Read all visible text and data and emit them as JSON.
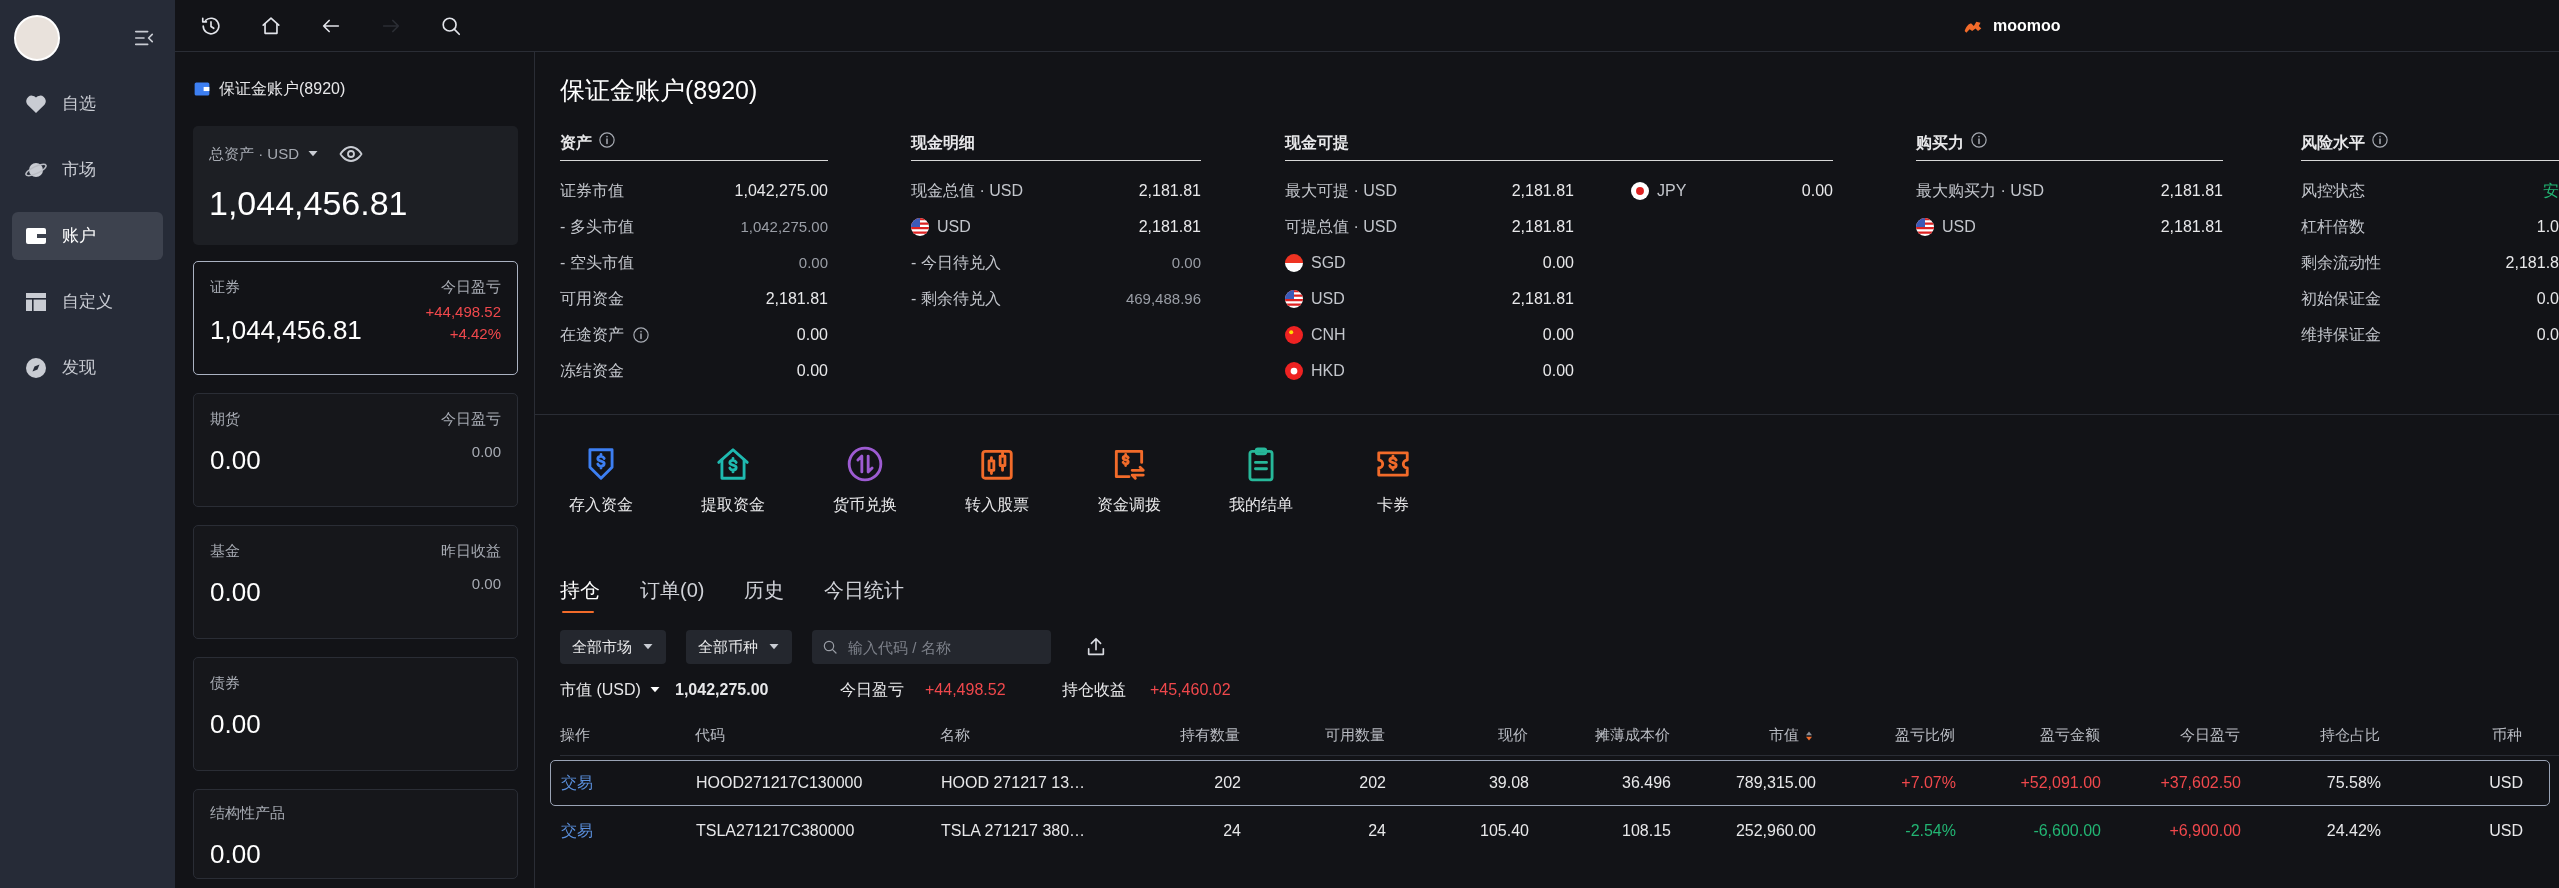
{
  "sidebar": {
    "items": [
      {
        "label": "自选",
        "selected": false
      },
      {
        "label": "市场",
        "selected": false
      },
      {
        "label": "账户",
        "selected": true
      },
      {
        "label": "自定义",
        "selected": false
      },
      {
        "label": "发现",
        "selected": false
      }
    ]
  },
  "toolbar": {
    "buttons": [
      {
        "disabled": false
      },
      {
        "disabled": false
      },
      {
        "disabled": false
      },
      {
        "disabled": true
      },
      {
        "disabled": false
      }
    ],
    "logo": "moomoo"
  },
  "account_panel": {
    "title": "保证金账户(8920)",
    "total": {
      "label": "总资产 · USD",
      "value": "1,044,456.81"
    },
    "cards": [
      {
        "name": "证券",
        "value": "1,044,456.81",
        "pnl_label": "今日盈亏",
        "pnl": "+44,498.52",
        "pnl_pct": "+4.42%",
        "kind": "up",
        "selected": true
      },
      {
        "name": "期货",
        "value": "0.00",
        "pnl_label": "今日盈亏",
        "pnl": "0.00",
        "kind": "flat",
        "selected": false
      },
      {
        "name": "基金",
        "value": "0.00",
        "pnl_label": "昨日收益",
        "pnl": "0.00",
        "kind": "flat",
        "selected": false
      },
      {
        "name": "债券",
        "value": "0.00",
        "selected": false
      },
      {
        "name": "结构性产品",
        "value": "0.00",
        "selected": false
      }
    ]
  },
  "page_title": "保证金账户(8920)",
  "sections": [
    {
      "title": "资产",
      "info": true,
      "columns": [
        [
          {
            "label": "证券市值",
            "value": "1,042,275.00",
            "kind": "plain"
          },
          {
            "label": "- 多头市值",
            "value": "1,042,275.00",
            "kind": "muted"
          },
          {
            "label": "- 空头市值",
            "value": "0.00",
            "kind": "muted"
          },
          {
            "label": "可用资金",
            "value": "2,181.81",
            "kind": "plain"
          },
          {
            "label": "在途资产",
            "value": "0.00",
            "kind": "info"
          },
          {
            "label": "冻结资金",
            "value": "0.00",
            "kind": "plain"
          }
        ]
      ]
    },
    {
      "title": "现金明细",
      "info": false,
      "columns": [
        [
          {
            "label": "现金总值 · USD",
            "value": "2,181.81",
            "kind": "plain"
          },
          {
            "label": "USD",
            "value": "2,181.81",
            "kind": "us"
          },
          {
            "label": "- 今日待兑入",
            "value": "0.00",
            "kind": "muted"
          },
          {
            "label": "- 剩余待兑入",
            "value": "469,488.96",
            "kind": "muted"
          }
        ]
      ]
    },
    {
      "title": "现金可提",
      "info": false,
      "columns": [
        [
          {
            "label": "最大可提 · USD",
            "value": "2,181.81",
            "kind": "plain"
          },
          {
            "label": "可提总值 · USD",
            "value": "2,181.81",
            "kind": "plain"
          },
          {
            "label": "SGD",
            "value": "0.00",
            "kind": "sg"
          },
          {
            "label": "USD",
            "value": "2,181.81",
            "kind": "us"
          },
          {
            "label": "CNH",
            "value": "0.00",
            "kind": "cn"
          },
          {
            "label": "HKD",
            "value": "0.00",
            "kind": "hk"
          }
        ],
        [
          {
            "label": "JPY",
            "value": "0.00",
            "kind": "jp"
          }
        ]
      ]
    },
    {
      "title": "购买力",
      "info": true,
      "columns": [
        [
          {
            "label": "最大购买力 · USD",
            "value": "2,181.81",
            "kind": "plain"
          },
          {
            "label": "USD",
            "value": "2,181.81",
            "kind": "us"
          }
        ]
      ]
    },
    {
      "title": "风险水平",
      "info": true,
      "columns": [
        [
          {
            "label": "风控状态",
            "value": "安",
            "kind": "safe"
          },
          {
            "label": "杠杆倍数",
            "value": "1.0",
            "kind": "plain"
          },
          {
            "label": "剩余流动性",
            "value": "2,181.8",
            "kind": "plain"
          },
          {
            "label": "初始保证金",
            "value": "0.0",
            "kind": "plain"
          },
          {
            "label": "维持保证金",
            "value": "0.0",
            "kind": "plain"
          }
        ]
      ]
    }
  ],
  "actions": [
    {
      "label": "存入资金",
      "color": "#3d7ff2"
    },
    {
      "label": "提取资金",
      "color": "#1fbab0"
    },
    {
      "label": "货币兑换",
      "color": "#9d5bd2"
    },
    {
      "label": "转入股票",
      "color": "#f26b2a"
    },
    {
      "label": "资金调拨",
      "color": "#f26b2a"
    },
    {
      "label": "我的结单",
      "color": "#27b89a"
    },
    {
      "label": "卡券",
      "color": "#f26b2a"
    }
  ],
  "tabs": [
    {
      "label": "持仓",
      "selected": true
    },
    {
      "label": "订单(0)",
      "selected": false
    },
    {
      "label": "历史",
      "selected": false
    },
    {
      "label": "今日统计",
      "selected": false
    }
  ],
  "filters": {
    "market": "全部市场",
    "currency": "全部币种",
    "search": {
      "placeholder": "输入代码 / 名称"
    }
  },
  "summary": [
    {
      "label": "市值 (USD)",
      "value": "1,042,275.00",
      "kind": "flat",
      "dropdown": true
    },
    {
      "label": "今日盈亏",
      "value": "+44,498.52",
      "kind": "up",
      "dropdown": false
    },
    {
      "label": "持仓收益",
      "value": "+45,460.02",
      "kind": "up",
      "dropdown": false
    }
  ],
  "table": {
    "columns": [
      {
        "label": "操作",
        "sorted": false
      },
      {
        "label": "代码",
        "sorted": false
      },
      {
        "label": "名称",
        "sorted": false
      },
      {
        "label": "持有数量",
        "sorted": false
      },
      {
        "label": "可用数量",
        "sorted": false
      },
      {
        "label": "现价",
        "sorted": false
      },
      {
        "label": "摊薄成本价",
        "sorted": false
      },
      {
        "label": "市值",
        "sorted": true
      },
      {
        "label": "盈亏比例",
        "sorted": false
      },
      {
        "label": "盈亏金额",
        "sorted": false
      },
      {
        "label": "今日盈亏",
        "sorted": false
      },
      {
        "label": "持仓占比",
        "sorted": false
      },
      {
        "label": "币种",
        "sorted": false
      }
    ],
    "rows": [
      {
        "selected": true,
        "cells": [
          {
            "text": "交易",
            "kind": "link"
          },
          {
            "text": "HOOD271217C130000",
            "kind": "plain"
          },
          {
            "text": "HOOD 271217 13…",
            "kind": "plain"
          },
          {
            "text": "202",
            "kind": "plain"
          },
          {
            "text": "202",
            "kind": "plain"
          },
          {
            "text": "39.08",
            "kind": "plain"
          },
          {
            "text": "36.496",
            "kind": "plain"
          },
          {
            "text": "789,315.00",
            "kind": "plain"
          },
          {
            "text": "+7.07%",
            "kind": "up"
          },
          {
            "text": "+52,091.00",
            "kind": "up"
          },
          {
            "text": "+37,602.50",
            "kind": "up"
          },
          {
            "text": "75.58%",
            "kind": "plain"
          },
          {
            "text": "USD",
            "kind": "plain"
          }
        ]
      },
      {
        "selected": false,
        "cells": [
          {
            "text": "交易",
            "kind": "link"
          },
          {
            "text": "TSLA271217C380000",
            "kind": "plain"
          },
          {
            "text": "TSLA 271217 380…",
            "kind": "plain"
          },
          {
            "text": "24",
            "kind": "plain"
          },
          {
            "text": "24",
            "kind": "plain"
          },
          {
            "text": "105.40",
            "kind": "plain"
          },
          {
            "text": "108.15",
            "kind": "plain"
          },
          {
            "text": "252,960.00",
            "kind": "plain"
          },
          {
            "text": "-2.54%",
            "kind": "down"
          },
          {
            "text": "-6,600.00",
            "kind": "down"
          },
          {
            "text": "+6,900.00",
            "kind": "up"
          },
          {
            "text": "24.42%",
            "kind": "plain"
          },
          {
            "text": "USD",
            "kind": "plain"
          }
        ]
      }
    ]
  }
}
